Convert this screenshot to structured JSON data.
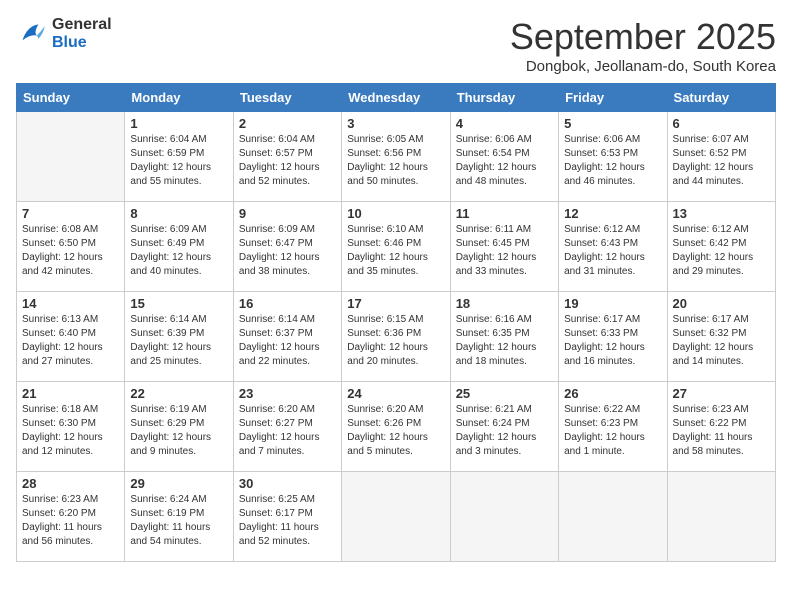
{
  "logo": {
    "general": "General",
    "blue": "Blue"
  },
  "header": {
    "month": "September 2025",
    "location": "Dongbok, Jeollanam-do, South Korea"
  },
  "days_of_week": [
    "Sunday",
    "Monday",
    "Tuesday",
    "Wednesday",
    "Thursday",
    "Friday",
    "Saturday"
  ],
  "weeks": [
    [
      {
        "day": "",
        "empty": true
      },
      {
        "day": "1",
        "sunrise": "Sunrise: 6:04 AM",
        "sunset": "Sunset: 6:59 PM",
        "daylight": "Daylight: 12 hours and 55 minutes."
      },
      {
        "day": "2",
        "sunrise": "Sunrise: 6:04 AM",
        "sunset": "Sunset: 6:57 PM",
        "daylight": "Daylight: 12 hours and 52 minutes."
      },
      {
        "day": "3",
        "sunrise": "Sunrise: 6:05 AM",
        "sunset": "Sunset: 6:56 PM",
        "daylight": "Daylight: 12 hours and 50 minutes."
      },
      {
        "day": "4",
        "sunrise": "Sunrise: 6:06 AM",
        "sunset": "Sunset: 6:54 PM",
        "daylight": "Daylight: 12 hours and 48 minutes."
      },
      {
        "day": "5",
        "sunrise": "Sunrise: 6:06 AM",
        "sunset": "Sunset: 6:53 PM",
        "daylight": "Daylight: 12 hours and 46 minutes."
      },
      {
        "day": "6",
        "sunrise": "Sunrise: 6:07 AM",
        "sunset": "Sunset: 6:52 PM",
        "daylight": "Daylight: 12 hours and 44 minutes."
      }
    ],
    [
      {
        "day": "7",
        "sunrise": "Sunrise: 6:08 AM",
        "sunset": "Sunset: 6:50 PM",
        "daylight": "Daylight: 12 hours and 42 minutes."
      },
      {
        "day": "8",
        "sunrise": "Sunrise: 6:09 AM",
        "sunset": "Sunset: 6:49 PM",
        "daylight": "Daylight: 12 hours and 40 minutes."
      },
      {
        "day": "9",
        "sunrise": "Sunrise: 6:09 AM",
        "sunset": "Sunset: 6:47 PM",
        "daylight": "Daylight: 12 hours and 38 minutes."
      },
      {
        "day": "10",
        "sunrise": "Sunrise: 6:10 AM",
        "sunset": "Sunset: 6:46 PM",
        "daylight": "Daylight: 12 hours and 35 minutes."
      },
      {
        "day": "11",
        "sunrise": "Sunrise: 6:11 AM",
        "sunset": "Sunset: 6:45 PM",
        "daylight": "Daylight: 12 hours and 33 minutes."
      },
      {
        "day": "12",
        "sunrise": "Sunrise: 6:12 AM",
        "sunset": "Sunset: 6:43 PM",
        "daylight": "Daylight: 12 hours and 31 minutes."
      },
      {
        "day": "13",
        "sunrise": "Sunrise: 6:12 AM",
        "sunset": "Sunset: 6:42 PM",
        "daylight": "Daylight: 12 hours and 29 minutes."
      }
    ],
    [
      {
        "day": "14",
        "sunrise": "Sunrise: 6:13 AM",
        "sunset": "Sunset: 6:40 PM",
        "daylight": "Daylight: 12 hours and 27 minutes."
      },
      {
        "day": "15",
        "sunrise": "Sunrise: 6:14 AM",
        "sunset": "Sunset: 6:39 PM",
        "daylight": "Daylight: 12 hours and 25 minutes."
      },
      {
        "day": "16",
        "sunrise": "Sunrise: 6:14 AM",
        "sunset": "Sunset: 6:37 PM",
        "daylight": "Daylight: 12 hours and 22 minutes."
      },
      {
        "day": "17",
        "sunrise": "Sunrise: 6:15 AM",
        "sunset": "Sunset: 6:36 PM",
        "daylight": "Daylight: 12 hours and 20 minutes."
      },
      {
        "day": "18",
        "sunrise": "Sunrise: 6:16 AM",
        "sunset": "Sunset: 6:35 PM",
        "daylight": "Daylight: 12 hours and 18 minutes."
      },
      {
        "day": "19",
        "sunrise": "Sunrise: 6:17 AM",
        "sunset": "Sunset: 6:33 PM",
        "daylight": "Daylight: 12 hours and 16 minutes."
      },
      {
        "day": "20",
        "sunrise": "Sunrise: 6:17 AM",
        "sunset": "Sunset: 6:32 PM",
        "daylight": "Daylight: 12 hours and 14 minutes."
      }
    ],
    [
      {
        "day": "21",
        "sunrise": "Sunrise: 6:18 AM",
        "sunset": "Sunset: 6:30 PM",
        "daylight": "Daylight: 12 hours and 12 minutes."
      },
      {
        "day": "22",
        "sunrise": "Sunrise: 6:19 AM",
        "sunset": "Sunset: 6:29 PM",
        "daylight": "Daylight: 12 hours and 9 minutes."
      },
      {
        "day": "23",
        "sunrise": "Sunrise: 6:20 AM",
        "sunset": "Sunset: 6:27 PM",
        "daylight": "Daylight: 12 hours and 7 minutes."
      },
      {
        "day": "24",
        "sunrise": "Sunrise: 6:20 AM",
        "sunset": "Sunset: 6:26 PM",
        "daylight": "Daylight: 12 hours and 5 minutes."
      },
      {
        "day": "25",
        "sunrise": "Sunrise: 6:21 AM",
        "sunset": "Sunset: 6:24 PM",
        "daylight": "Daylight: 12 hours and 3 minutes."
      },
      {
        "day": "26",
        "sunrise": "Sunrise: 6:22 AM",
        "sunset": "Sunset: 6:23 PM",
        "daylight": "Daylight: 12 hours and 1 minute."
      },
      {
        "day": "27",
        "sunrise": "Sunrise: 6:23 AM",
        "sunset": "Sunset: 6:22 PM",
        "daylight": "Daylight: 11 hours and 58 minutes."
      }
    ],
    [
      {
        "day": "28",
        "sunrise": "Sunrise: 6:23 AM",
        "sunset": "Sunset: 6:20 PM",
        "daylight": "Daylight: 11 hours and 56 minutes."
      },
      {
        "day": "29",
        "sunrise": "Sunrise: 6:24 AM",
        "sunset": "Sunset: 6:19 PM",
        "daylight": "Daylight: 11 hours and 54 minutes."
      },
      {
        "day": "30",
        "sunrise": "Sunrise: 6:25 AM",
        "sunset": "Sunset: 6:17 PM",
        "daylight": "Daylight: 11 hours and 52 minutes."
      },
      {
        "day": "",
        "empty": true
      },
      {
        "day": "",
        "empty": true
      },
      {
        "day": "",
        "empty": true
      },
      {
        "day": "",
        "empty": true
      }
    ]
  ]
}
